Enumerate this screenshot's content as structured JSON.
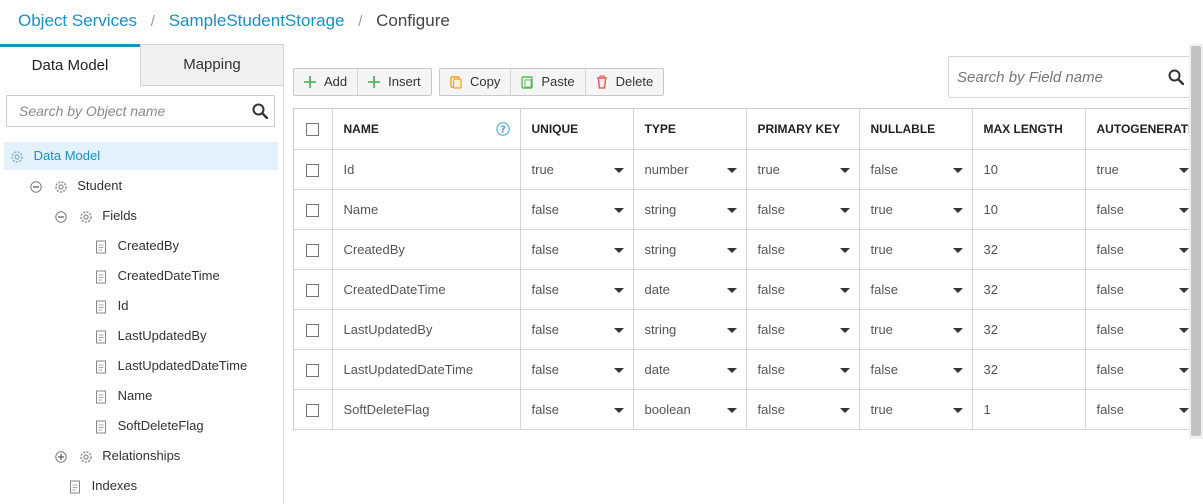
{
  "breadcrumb": {
    "items": [
      "Object Services",
      "SampleStudentStorage",
      "Configure"
    ],
    "separator": "/"
  },
  "left_panel": {
    "tabs": [
      {
        "label": "Data Model",
        "active": true
      },
      {
        "label": "Mapping",
        "active": false
      }
    ],
    "search": {
      "placeholder": "Search by Object name",
      "value": ""
    },
    "tree": {
      "root": "Data Model",
      "object": "Student",
      "fields_node": "Fields",
      "fields": [
        "CreatedBy",
        "CreatedDateTime",
        "Id",
        "LastUpdatedBy",
        "LastUpdatedDateTime",
        "Name",
        "SoftDeleteFlag"
      ],
      "relationships_node": "Relationships",
      "indexes_node": "Indexes"
    }
  },
  "toolbar": {
    "add": "Add",
    "insert": "Insert",
    "copy": "Copy",
    "paste": "Paste",
    "delete": "Delete"
  },
  "field_search": {
    "placeholder": "Search by Field name",
    "value": ""
  },
  "grid": {
    "columns": [
      "NAME",
      "UNIQUE",
      "TYPE",
      "PRIMARY KEY",
      "NULLABLE",
      "MAX LENGTH",
      "AUTOGENERATED"
    ],
    "rows": [
      {
        "name": "Id",
        "unique": "true",
        "type": "number",
        "primary_key": "true",
        "nullable": "false",
        "max_length": "10",
        "autogenerated": "true"
      },
      {
        "name": "Name",
        "unique": "false",
        "type": "string",
        "primary_key": "false",
        "nullable": "true",
        "max_length": "10",
        "autogenerated": "false"
      },
      {
        "name": "CreatedBy",
        "unique": "false",
        "type": "string",
        "primary_key": "false",
        "nullable": "true",
        "max_length": "32",
        "autogenerated": "false"
      },
      {
        "name": "CreatedDateTime",
        "unique": "false",
        "type": "date",
        "primary_key": "false",
        "nullable": "false",
        "max_length": "32",
        "autogenerated": "false"
      },
      {
        "name": "LastUpdatedBy",
        "unique": "false",
        "type": "string",
        "primary_key": "false",
        "nullable": "true",
        "max_length": "32",
        "autogenerated": "false"
      },
      {
        "name": "LastUpdatedDateTime",
        "unique": "false",
        "type": "date",
        "primary_key": "false",
        "nullable": "false",
        "max_length": "32",
        "autogenerated": "false"
      },
      {
        "name": "SoftDeleteFlag",
        "unique": "false",
        "type": "boolean",
        "primary_key": "false",
        "nullable": "true",
        "max_length": "1",
        "autogenerated": "false"
      }
    ]
  },
  "colors": {
    "accent": "#1b8fc8",
    "selected_bg": "#e3f1fa",
    "add_icon": "#4caf50",
    "copy_icon": "#f0a020",
    "paste_icon": "#5cb85c",
    "delete_icon": "#d9534f"
  }
}
